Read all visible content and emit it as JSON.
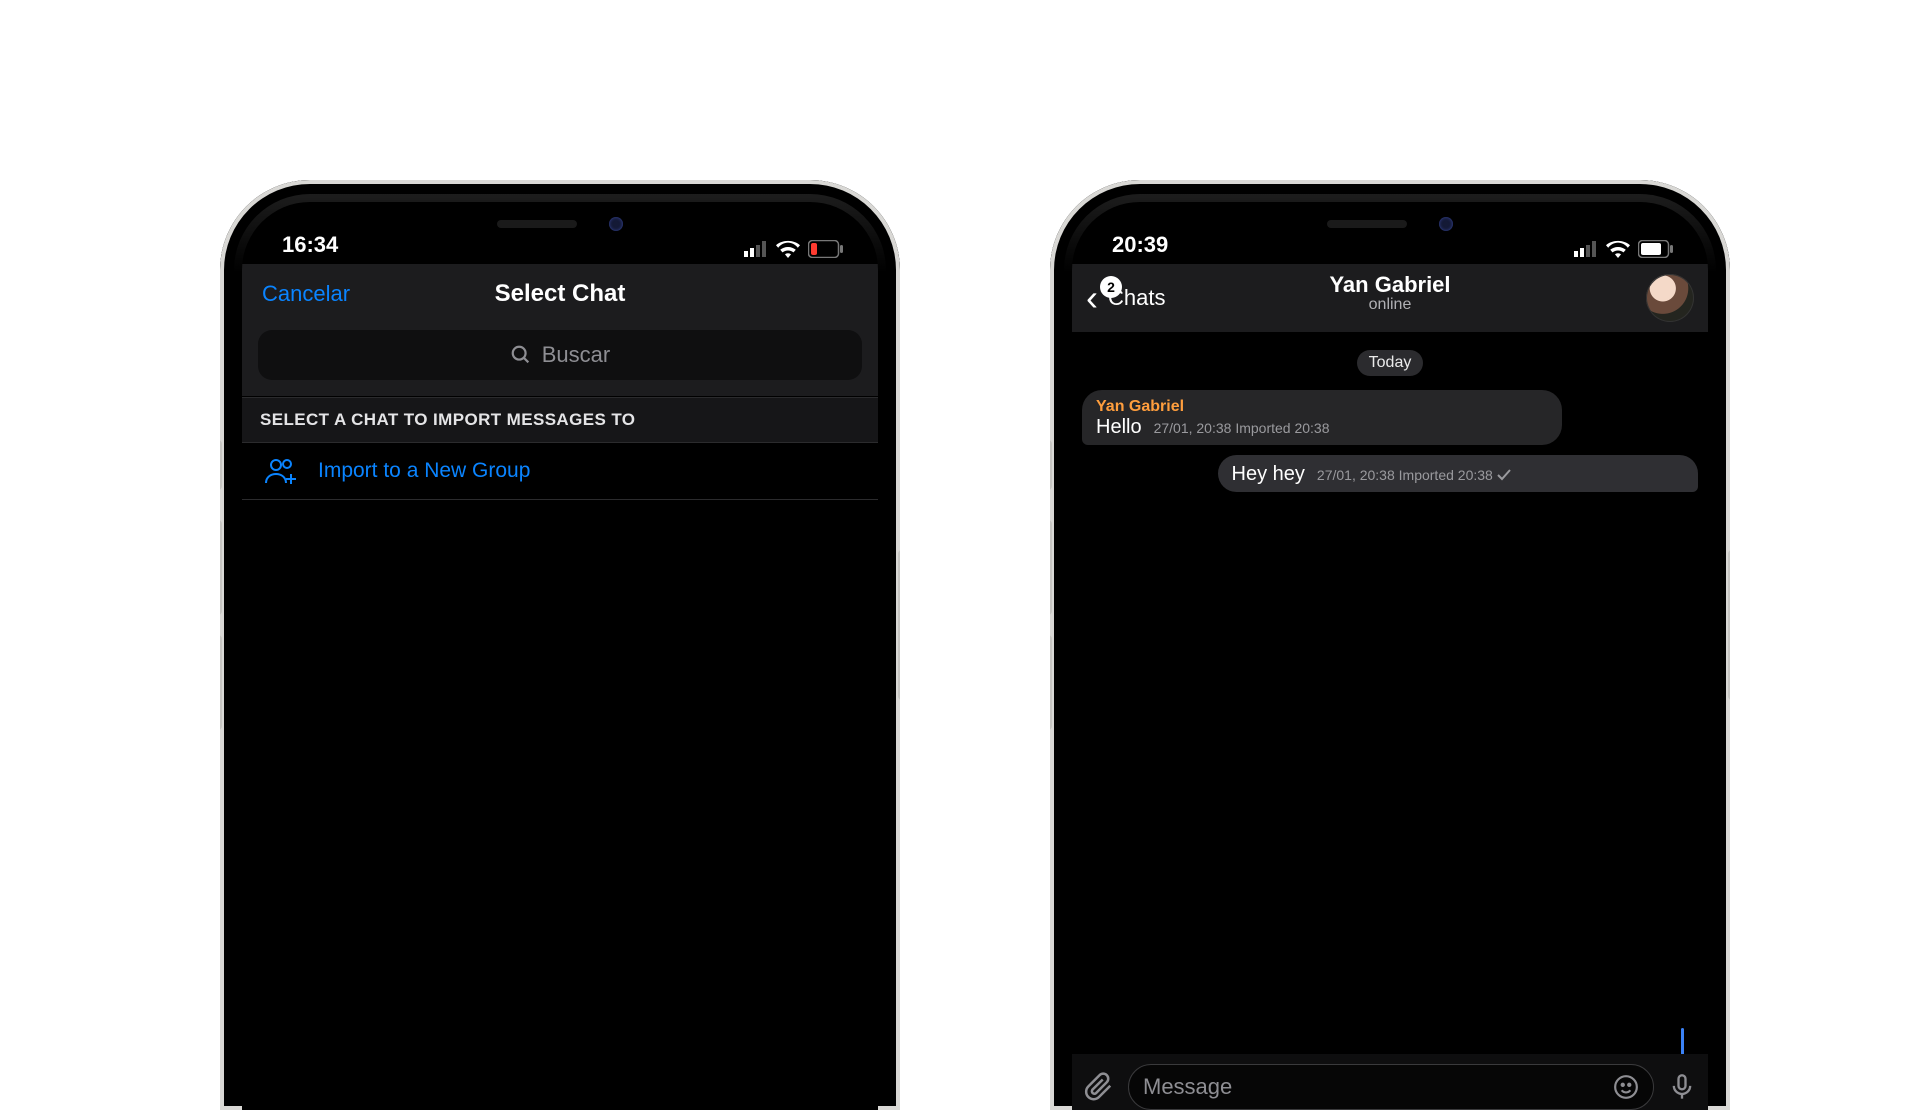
{
  "accent": "#0a84ff",
  "sender_color": "#ff9e3d",
  "phone1": {
    "status_time": "16:34",
    "battery_low": true,
    "navbar": {
      "cancel": "Cancelar",
      "title": "Select Chat"
    },
    "search_placeholder": "Buscar",
    "section_header": "SELECT A CHAT TO IMPORT MESSAGES TO",
    "import_row": "Import to a New Group"
  },
  "phone2": {
    "status_time": "20:39",
    "battery_low": false,
    "header": {
      "back_label": "Chats",
      "badge": "2",
      "name": "Yan Gabriel",
      "status": "online"
    },
    "day_label": "Today",
    "messages": [
      {
        "dir": "in",
        "sender": "Yan Gabriel",
        "text": "Hello",
        "meta": "27/01, 20:38 Imported 20:38"
      },
      {
        "dir": "out",
        "text": "Hey hey",
        "meta": "27/01, 20:38 Imported 20:38",
        "check": true
      }
    ],
    "compose_placeholder": "Message"
  }
}
